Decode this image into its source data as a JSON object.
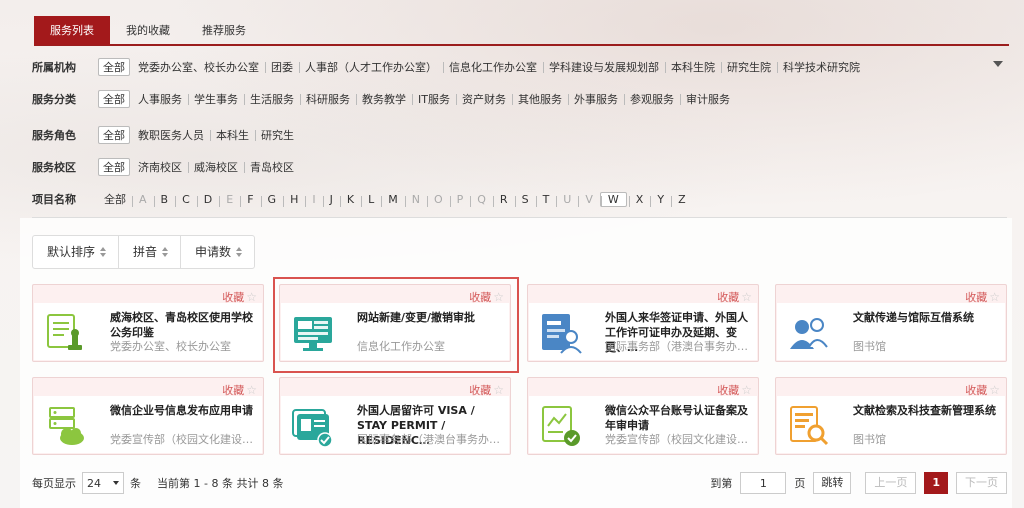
{
  "tabs": [
    {
      "label": "服务列表",
      "active": true
    },
    {
      "label": "我的收藏",
      "active": false
    },
    {
      "label": "推荐服务",
      "active": false
    }
  ],
  "filters": {
    "org": {
      "label": "所属机构",
      "items": [
        "全部",
        "党委办公室、校长办公室",
        "团委",
        "人事部（人才工作办公室）",
        "信息化工作办公室",
        "学科建设与发展规划部",
        "本科生院",
        "研究生院",
        "科学技术研究院"
      ]
    },
    "category": {
      "label": "服务分类",
      "items": [
        "全部",
        "人事服务",
        "学生事务",
        "生活服务",
        "科研服务",
        "教务教学",
        "IT服务",
        "资产财务",
        "其他服务",
        "外事服务",
        "参观服务",
        "审计服务"
      ]
    },
    "role": {
      "label": "服务角色",
      "items": [
        "全部",
        "教职医务人员",
        "本科生",
        "研究生"
      ]
    },
    "campus": {
      "label": "服务校区",
      "items": [
        "全部",
        "济南校区",
        "威海校区",
        "青岛校区"
      ]
    },
    "name": {
      "label": "项目名称",
      "all": "全部",
      "letters": [
        "A",
        "B",
        "C",
        "D",
        "E",
        "F",
        "G",
        "H",
        "I",
        "J",
        "K",
        "L",
        "M",
        "N",
        "O",
        "P",
        "Q",
        "R",
        "S",
        "T",
        "U",
        "V",
        "W",
        "X",
        "Y",
        "Z"
      ],
      "disabled": [
        "A",
        "E",
        "I",
        "N",
        "O",
        "P",
        "Q",
        "U",
        "V"
      ],
      "selected": "W"
    }
  },
  "sort": [
    {
      "label": "默认排序"
    },
    {
      "label": "拼音"
    },
    {
      "label": "申请数"
    }
  ],
  "fav_label": "收藏",
  "cards": [
    {
      "title": "威海校区、青岛校区使用学校公务印鉴",
      "dept": "党委办公室、校长办公室",
      "icon": "seal-icon"
    },
    {
      "title": "网站新建/变更/撤销审批",
      "dept": "信息化工作办公室",
      "icon": "monitor-icon"
    },
    {
      "title": "外国人来华签证申请、外国人工作许可证申办及延期、变更、…",
      "dept": "国际事务部（港澳台事务办公室）",
      "icon": "id-card-icon"
    },
    {
      "title": "文献传递与馆际互借系统",
      "dept": "图书馆",
      "icon": "users-icon"
    },
    {
      "title": "微信企业号信息发布应用申请",
      "dept": "党委宣传部（校园文化建设工作…",
      "icon": "server-cloud-icon"
    },
    {
      "title": "外国人居留许可 VISA / STAY PERMIT / RESIDENC…",
      "dept": "国际事务部（港澳台事务办公室）",
      "icon": "permit-icon"
    },
    {
      "title": "微信公众平台账号认证备案及年审申请",
      "dept": "党委宣传部（校园文化建设工作…",
      "icon": "certificate-icon"
    },
    {
      "title": "文献检索及科技查新管理系统",
      "dept": "图书馆",
      "icon": "doc-search-icon"
    }
  ],
  "footer": {
    "per_page_label": "每页显示",
    "per_page": "24",
    "unit": "条",
    "summary": "当前第 1 - 8 条 共计 8 条",
    "goto_label": "到第",
    "page_input": "1",
    "page_unit": "页",
    "jump": "跳转",
    "prev": "上一页",
    "current": "1",
    "next": "下一页"
  },
  "colors": {
    "brand": "#a3191b",
    "accent": "#d9534f",
    "icon_green": "#8cc63f",
    "icon_teal": "#2aa79b",
    "icon_blue": "#4a86c5",
    "icon_orange": "#f0a030"
  }
}
